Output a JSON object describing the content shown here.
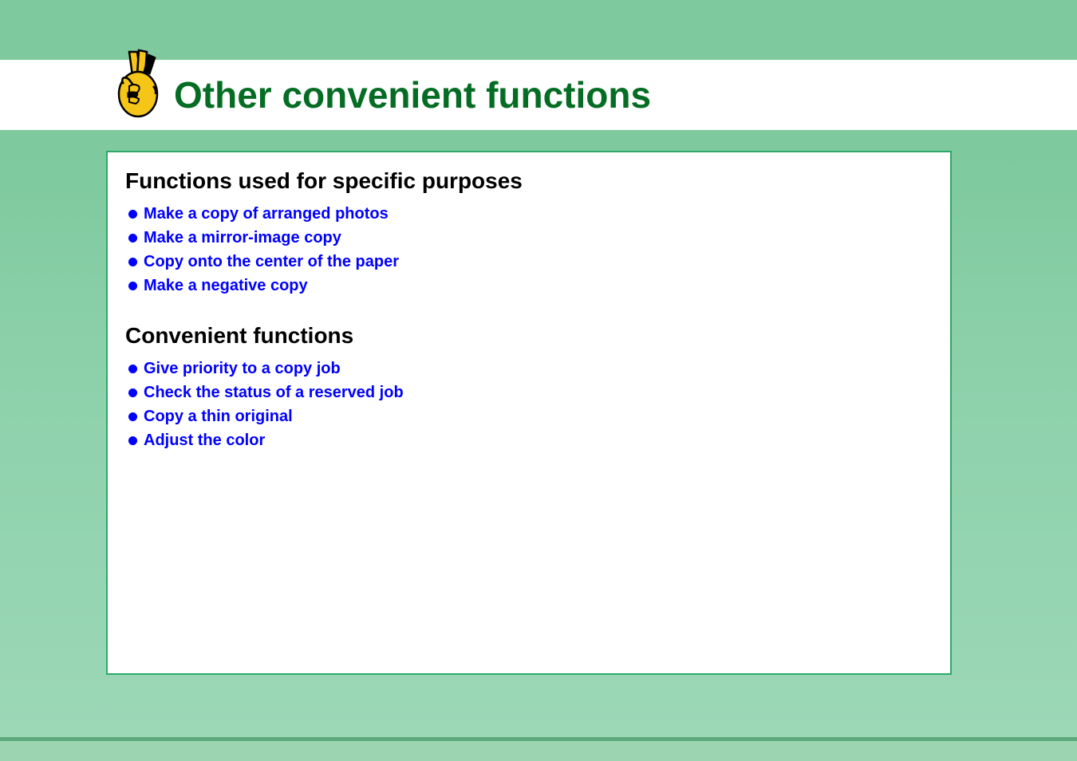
{
  "header": {
    "title": "Other convenient functions"
  },
  "sections": [
    {
      "heading": "Functions used for specific purposes",
      "items": [
        "Make a copy of arranged photos",
        "Make a mirror-image copy",
        "Copy onto the center of the paper",
        "Make a negative copy"
      ]
    },
    {
      "heading": "Convenient functions",
      "items": [
        "Give priority to a copy job",
        "Check the status of a reserved job",
        "Copy a thin original",
        "Adjust the color"
      ]
    }
  ]
}
